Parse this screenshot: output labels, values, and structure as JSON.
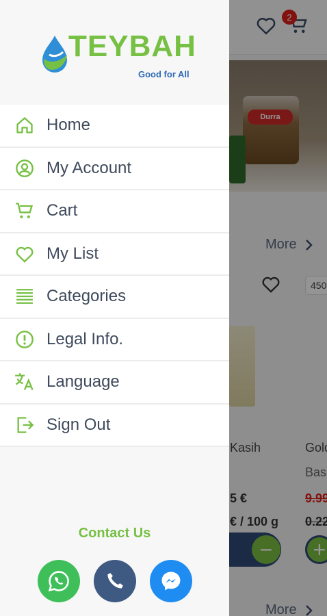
{
  "background": {
    "header": {
      "cart_badge": "2"
    },
    "banner": {
      "brand_label": "Durra"
    },
    "sections": [
      {
        "more_label": "More"
      },
      {
        "more_label": "More"
      }
    ],
    "products": [
      {
        "weight": "450",
        "name": "Kasih",
        "sub": "",
        "price": "5 €",
        "unit_price": "€ / 100 g",
        "qty_action": "−"
      },
      {
        "weight": "",
        "name": "Gold",
        "sub": "Basm",
        "price": "9.99",
        "unit_price": "0.22",
        "qty_action": "+"
      }
    ]
  },
  "drawer": {
    "logo": {
      "name": "TEYBAH",
      "tagline": "Good for All"
    },
    "menu": [
      {
        "label": "Home",
        "icon": "home-icon"
      },
      {
        "label": "My Account",
        "icon": "account-icon"
      },
      {
        "label": "Cart",
        "icon": "cart-icon"
      },
      {
        "label": "My List",
        "icon": "heart-icon"
      },
      {
        "label": "Categories",
        "icon": "list-icon"
      },
      {
        "label": "Legal Info.",
        "icon": "info-icon"
      },
      {
        "label": "Language",
        "icon": "translate-icon"
      },
      {
        "label": "Sign Out",
        "icon": "sign-out-icon"
      }
    ],
    "contact": {
      "title": "Contact Us",
      "buttons": [
        {
          "icon": "whatsapp-icon",
          "color": "#3fbf5a"
        },
        {
          "icon": "phone-icon",
          "color": "#3f5a82"
        },
        {
          "icon": "messenger-icon",
          "color": "#1f8cf2"
        }
      ]
    }
  },
  "colors": {
    "brand_green": "#76c043",
    "brand_blue": "#2f6bb5",
    "menu_text": "#3f4a5c",
    "badge_red": "#e0201b"
  }
}
